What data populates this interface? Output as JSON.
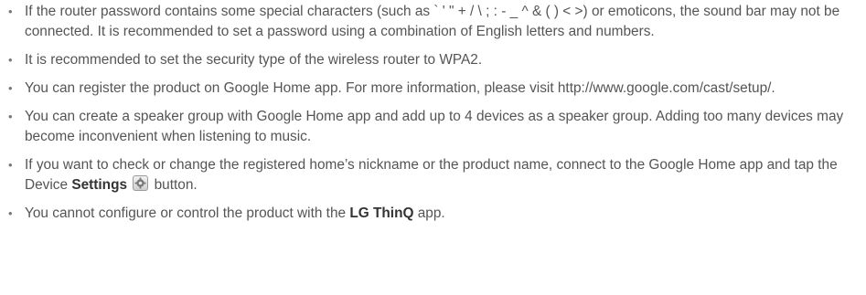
{
  "notes": [
    {
      "text": "If the router password contains some special characters (such as ` ' \" + / \\ ; : - _ ^ & ( ) < >) or emoticons, the sound bar may not be connected. It is recommended to set a password using a combination of English letters and numbers."
    },
    {
      "text": "It is recommended to set the security type of the wireless router to WPA2."
    },
    {
      "text": "You can register the product on Google Home app. For more information, please visit http://www.google.com/cast/setup/."
    },
    {
      "text": "You can create a speaker group with Google Home app and add up to 4 devices as a speaker group. Adding too many devices may become inconvenient when listening to music."
    },
    {
      "before": "If you want to check or change the registered home’s nickname or the product name, connect to the Google Home app and tap the Device ",
      "bold": "Settings",
      "after": " button.",
      "icon": "gear-icon"
    },
    {
      "before": "You cannot configure or control the product with the ",
      "bold": "LG ThinQ",
      "after": " app."
    }
  ],
  "bullet_char": "•"
}
